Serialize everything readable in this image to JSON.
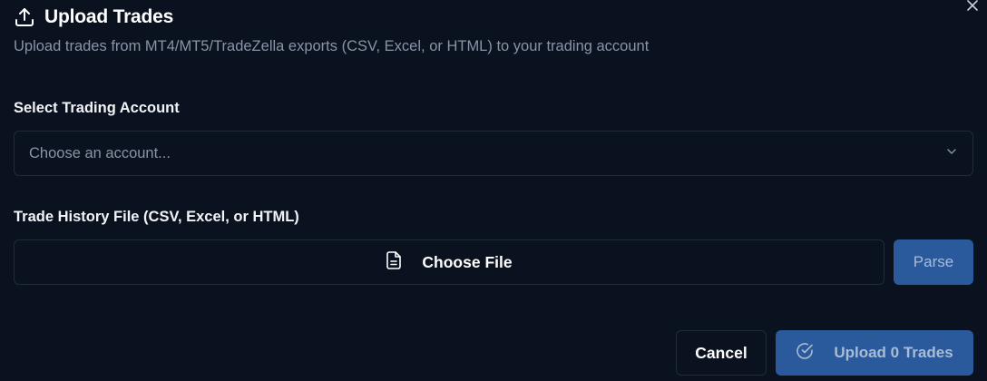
{
  "dialog": {
    "title": "Upload Trades",
    "title_icon": "upload-icon",
    "subtitle": "Upload trades from MT4/MT5/TradeZella exports (CSV, Excel, or HTML) to your trading account",
    "close_icon": "close-icon"
  },
  "account": {
    "label": "Select Trading Account",
    "placeholder": "Choose an account...",
    "icon": "chevron-down-icon"
  },
  "file": {
    "label": "Trade History File (CSV, Excel, or HTML)",
    "choose_label": "Choose File",
    "choose_icon": "file-icon",
    "parse_label": "Parse"
  },
  "footer": {
    "cancel_label": "Cancel",
    "upload_label": "Upload 0 Trades",
    "upload_icon": "check-circle-icon"
  },
  "colors": {
    "background": "#0a1220",
    "border": "#1f2b3d",
    "primary_disabled": "#2a5a9c",
    "muted_text": "#8a94a6"
  }
}
